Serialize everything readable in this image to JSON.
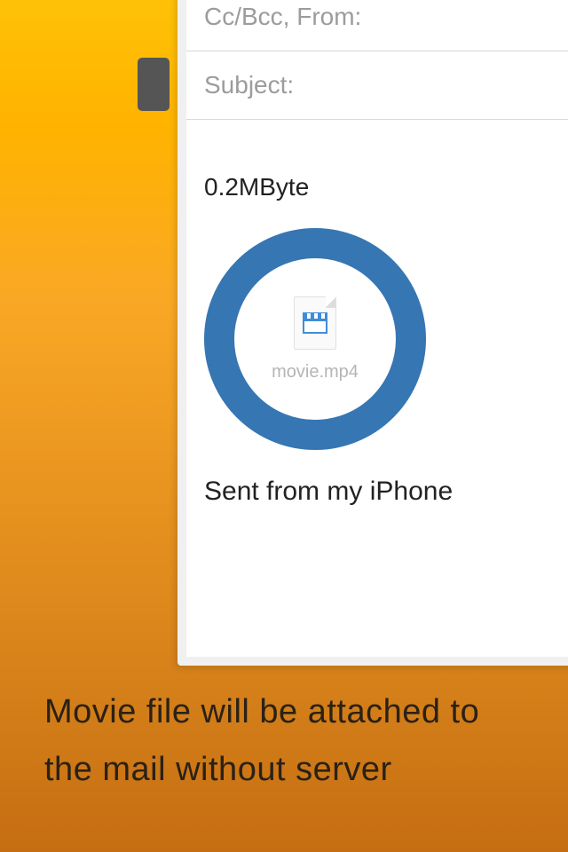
{
  "compose": {
    "ccbcc_label": "Cc/Bcc, From:",
    "subject_label": "Subject:",
    "filesize": "0.2MByte",
    "attachment_name": "movie.mp4",
    "signature": "Sent from my iPhone"
  },
  "caption": "Movie file will be attached to the mail without server"
}
